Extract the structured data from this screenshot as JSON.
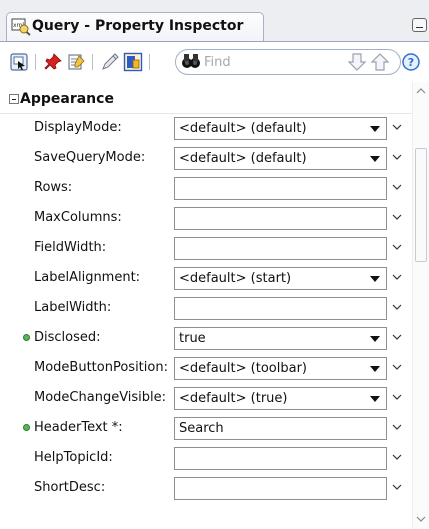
{
  "panel": {
    "title": "Query - Property Inspector"
  },
  "toolbar": {
    "find_placeholder": "Find",
    "icons": [
      "select-icon",
      "pin-icon",
      "edit-properties-icon",
      "pencil-icon",
      "bind-icon",
      "binoculars-icon",
      "arrow-down-icon",
      "arrow-up-icon",
      "help-icon"
    ]
  },
  "section": {
    "title": "Appearance"
  },
  "properties": [
    {
      "label": "DisplayMode:",
      "value": "<default> (default)",
      "kind": "select",
      "modified": false
    },
    {
      "label": "SaveQueryMode:",
      "value": "<default> (default)",
      "kind": "select",
      "modified": false
    },
    {
      "label": "Rows:",
      "value": "",
      "kind": "text",
      "modified": false
    },
    {
      "label": "MaxColumns:",
      "value": "",
      "kind": "text",
      "modified": false
    },
    {
      "label": "FieldWidth:",
      "value": "",
      "kind": "text",
      "modified": false
    },
    {
      "label": "LabelAlignment:",
      "value": "<default> (start)",
      "kind": "select",
      "modified": false
    },
    {
      "label": "LabelWidth:",
      "value": "",
      "kind": "text",
      "modified": false
    },
    {
      "label": "Disclosed:",
      "value": "true",
      "kind": "select",
      "modified": true
    },
    {
      "label": "ModeButtonPosition:",
      "value": "<default> (toolbar)",
      "kind": "select",
      "modified": false
    },
    {
      "label": "ModeChangeVisible:",
      "value": "<default> (true)",
      "kind": "select",
      "modified": false
    },
    {
      "label": "HeaderText *:",
      "value": "Search",
      "kind": "text",
      "modified": true
    },
    {
      "label": "HelpTopicId:",
      "value": "",
      "kind": "text",
      "modified": false
    },
    {
      "label": "ShortDesc:",
      "value": "",
      "kind": "text",
      "modified": false
    }
  ],
  "colors": {
    "modified_dot": "#59b45a",
    "tab_border": "#a7b2c3",
    "accent_blue": "#2f6fd1"
  }
}
